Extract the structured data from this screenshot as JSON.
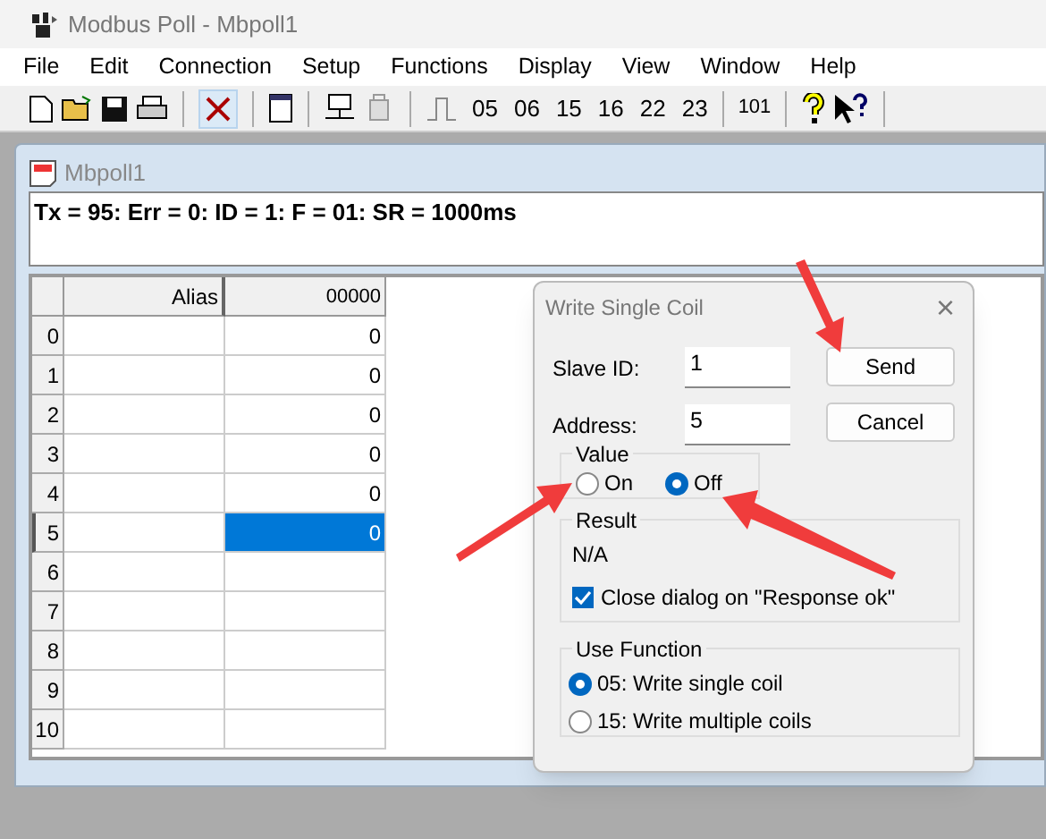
{
  "window": {
    "title": "Modbus Poll - Mbpoll1"
  },
  "menu": [
    "File",
    "Edit",
    "Connection",
    "Setup",
    "Functions",
    "Display",
    "View",
    "Window",
    "Help"
  ],
  "toolbar": {
    "function_codes": [
      "05",
      "06",
      "15",
      "16",
      "22",
      "23"
    ],
    "address_button": "101"
  },
  "child_window": {
    "title": "Mbpoll1",
    "status": "Tx = 95: Err = 0: ID = 1: F = 01: SR = 1000ms"
  },
  "grid": {
    "columns": [
      "Alias",
      "00000"
    ],
    "rows": [
      {
        "header": "0",
        "value": "0",
        "selected": false
      },
      {
        "header": "1",
        "value": "0",
        "selected": false
      },
      {
        "header": "2",
        "value": "0",
        "selected": false
      },
      {
        "header": "3",
        "value": "0",
        "selected": false
      },
      {
        "header": "4",
        "value": "0",
        "selected": false
      },
      {
        "header": "5",
        "value": "0",
        "selected": true
      },
      {
        "header": "6",
        "selected": false
      },
      {
        "header": "7",
        "selected": false
      },
      {
        "header": "8",
        "selected": false
      },
      {
        "header": "9",
        "selected": false
      },
      {
        "header": "10",
        "selected": false
      }
    ]
  },
  "dialog": {
    "title": "Write Single Coil",
    "close": "×",
    "fields": [
      {
        "label": "Slave ID:",
        "value": "1"
      },
      {
        "label": "Address:",
        "value": "5"
      }
    ],
    "buttons": [
      "Send",
      "Cancel"
    ],
    "value_group": {
      "title": "Value",
      "options": [
        {
          "label": "On",
          "selected": false
        },
        {
          "label": "Off",
          "selected": true
        }
      ]
    },
    "result_group": {
      "title": "Result",
      "text": "N/A",
      "checkbox": {
        "label": "Close dialog on \"Response ok\"",
        "checked": true
      }
    },
    "function_group": {
      "title": "Use Function",
      "options": [
        {
          "label": "05: Write single coil",
          "selected": true
        },
        {
          "label": "15: Write multiple coils",
          "selected": false
        }
      ]
    }
  }
}
